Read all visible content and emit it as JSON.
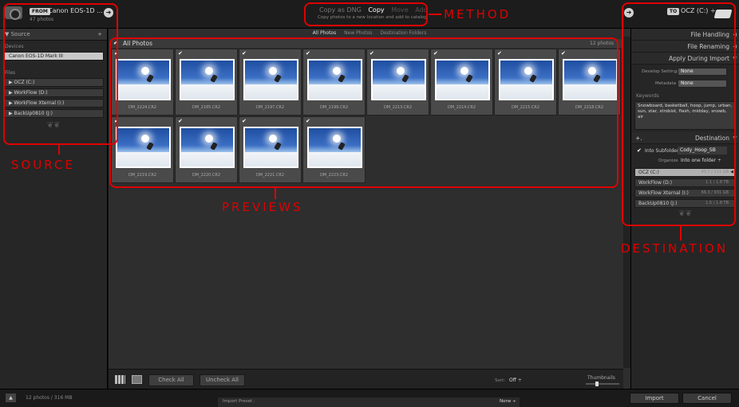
{
  "top": {
    "from_tag": "FROM",
    "source_name": "Canon EOS-1D ...",
    "source_count": "47 photos",
    "methods": [
      "Copy as DNG",
      "Copy",
      "Move",
      "Add"
    ],
    "method_desc": "Copy photos to a new location and add to catalog",
    "to_tag": "TO",
    "dest_name": "OCZ (C:) ÷"
  },
  "source": {
    "header": "Source",
    "devices_label": "Devices",
    "device": "Canon EOS-1D Mark III",
    "files_label": "Files",
    "drives": [
      "OCZ (C:)",
      "WorkFlow (D:)",
      "WorkFlow Xternal (I:)",
      "BackUp0810 (J:)"
    ]
  },
  "center": {
    "tabs": [
      "All Photos",
      "New Photos",
      "Destination Folders"
    ],
    "grid_header": "All Photos",
    "photo_count": "12 photos",
    "photos": [
      "DM_2224.CR2",
      "DM_2185.CR2",
      "DM_2197.CR2",
      "DM_2199.CR2",
      "DM_2213.CR2",
      "DM_2214.CR2",
      "DM_2215.CR2",
      "DM_2218.CR2",
      "DM_2219.CR2",
      "DM_2220.CR2",
      "DM_2221.CR2",
      "DM_2223.CR2"
    ]
  },
  "toolbar": {
    "check_all": "Check All",
    "uncheck_all": "Uncheck All",
    "sort_label": "Sort:",
    "sort_value": "Off ÷",
    "thumbnails_label": "Thumbnails"
  },
  "right": {
    "file_handling": "File Handling",
    "file_renaming": "File Renaming",
    "apply_during_import": "Apply During Import",
    "develop_label": "Develop Settings",
    "develop_value": "None",
    "metadata_label": "Metadata",
    "metadata_value": "None",
    "keywords_label": "Keywords",
    "keywords_text": "Snowboard, basketball, hoop, jump, urban, sun, star, strobist, flash, midday, snowb, air",
    "destination": "Destination",
    "into_subfolder_label": "Into Subfolder",
    "subfolder_name": "Cody_Hoop_SB",
    "organize_label": "Organize",
    "organize_value": "Into one folder ÷",
    "drives": [
      {
        "name": "OCZ (C:)",
        "size": "40.7 / 111 GB"
      },
      {
        "name": "WorkFlow (D:)",
        "size": "1.1 / 1.8 TB"
      },
      {
        "name": "WorkFlow Xternal (I:)",
        "size": "66.3 / 931 GB"
      },
      {
        "name": "BackUp0810 (J:)",
        "size": "1.5 / 1.8 TB"
      }
    ]
  },
  "bottom": {
    "status": "12 photos / 316 MB",
    "preset_label": "Import Preset :",
    "preset_value": "None ÷",
    "import": "Import",
    "cancel": "Cancel"
  },
  "annotations": {
    "method": "METHOD",
    "source": "SOURCE",
    "previews": "PREVIEWS",
    "destination": "DESTINATION"
  }
}
